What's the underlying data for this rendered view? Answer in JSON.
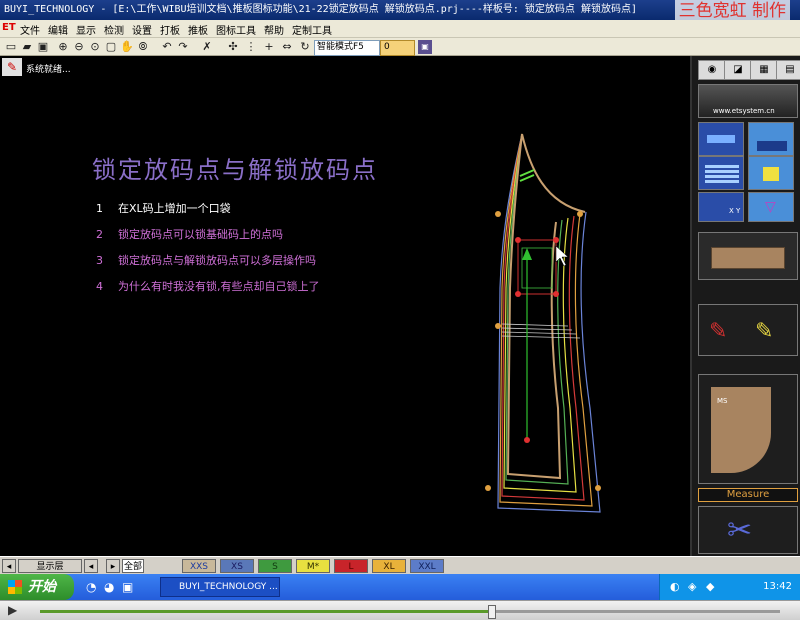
{
  "window": {
    "title": "BUYI_TECHNOLOGY - [E:\\工作\\WIBU培训文档\\推板图标功能\\21-22锁定放码点  解锁放码点.prj----样板号: 锁定放码点  解锁放码点]",
    "watermark": "三色宽虹 制作"
  },
  "menu": {
    "logo": "ET",
    "items": [
      "文件",
      "编辑",
      "显示",
      "检测",
      "设置",
      "打板",
      "推板",
      "图标工具",
      "帮助",
      "定制工具"
    ]
  },
  "toolbar": {
    "mode_select": "智能模式F5",
    "zoom_value": "0"
  },
  "status": {
    "text": "系统就绪..."
  },
  "canvas": {
    "heading": "锁定放码点与解锁放码点",
    "steps": [
      {
        "num": "1",
        "text": "在XL码上增加一个口袋",
        "color": "#ffffff"
      },
      {
        "num": "2",
        "text": "锁定放码点可以锁基础码上的点吗",
        "color": "#d070d8"
      },
      {
        "num": "3",
        "text": "锁定放码点与解锁放码点可以多层操作吗",
        "color": "#d070d8"
      },
      {
        "num": "4",
        "text": "为什么有时我没有锁,有些点却自己锁上了",
        "color": "#d070d8"
      }
    ]
  },
  "palette": {
    "website": "www.etsystem.cn",
    "measure_label": "Measure",
    "xy_label": "X Y",
    "ms_label": "MS"
  },
  "layerbar": {
    "show_layer": "显示层",
    "all_label": "全部",
    "sizes": [
      {
        "label": "XXS",
        "bg": "#c8b89a",
        "fg": "#1a3aa0"
      },
      {
        "label": "XS",
        "bg": "#5a78b8",
        "fg": "#1a1a60"
      },
      {
        "label": "S",
        "bg": "#3f9a3f",
        "fg": "#103a10"
      },
      {
        "label": "M*",
        "bg": "#e8e040",
        "fg": "#303000"
      },
      {
        "label": "L",
        "bg": "#c8242a",
        "fg": "#5a0000"
      },
      {
        "label": "XL",
        "bg": "#e8b23a",
        "fg": "#3a2000"
      },
      {
        "label": "XXL",
        "bg": "#5c7cc8",
        "fg": "#10205a"
      }
    ]
  },
  "taskbar": {
    "start": "开始",
    "app": "BUYI_TECHNOLOGY ...",
    "clock": "13:42"
  },
  "player": {
    "progress": 0.61
  }
}
